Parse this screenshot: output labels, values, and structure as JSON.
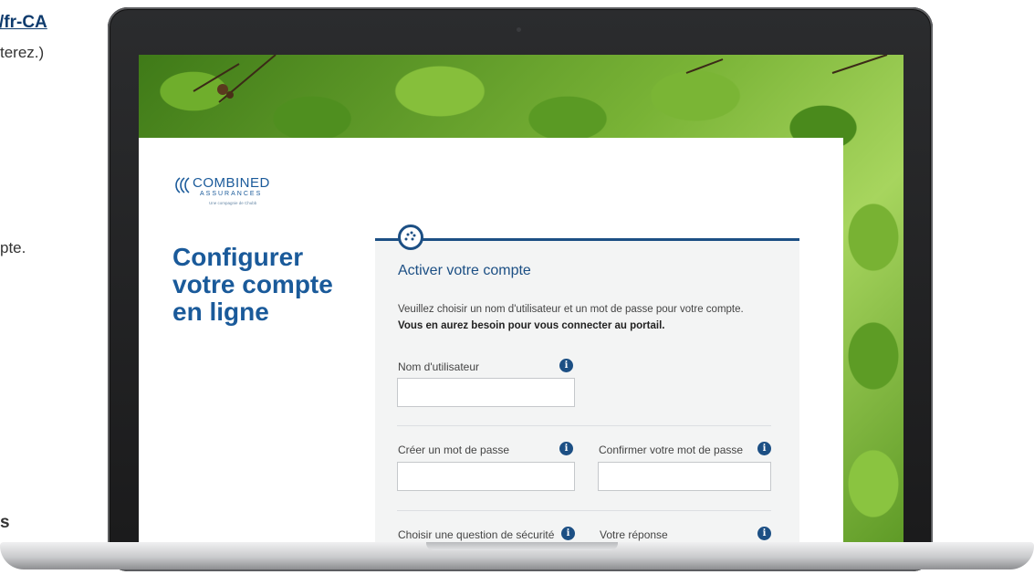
{
  "background_page": {
    "link_fragment": "/fr-CA",
    "line2_fragment": "terez.)",
    "line3_fragment": "pte.",
    "line4_fragment": "s"
  },
  "brand": {
    "logo_main": "COMBINED",
    "logo_sub": "ASSURANCES",
    "logo_tagline": "Une compagnie de Chubb"
  },
  "page": {
    "title": "Configurer votre compte en ligne"
  },
  "card": {
    "title": "Activer votre compte",
    "description": "Veuillez choisir un nom d'utilisateur et un mot de passe pour votre compte.",
    "description_bold": "Vous en aurez besoin pour vous connecter au portail."
  },
  "form": {
    "username_label": "Nom d'utilisateur",
    "username_value": "",
    "password_label": "Créer un mot de passe",
    "password_value": "",
    "confirm_label": "Confirmer votre mot de passe",
    "confirm_value": "",
    "question_label": "Choisir une question de sécurité",
    "answer_label": "Votre réponse",
    "info_glyph": "i"
  },
  "colors": {
    "brand_blue": "#1a5a9a",
    "card_accent": "#1c4f84"
  },
  "icons": {
    "card_badge": "dots-circle-icon",
    "info": "info-icon"
  }
}
